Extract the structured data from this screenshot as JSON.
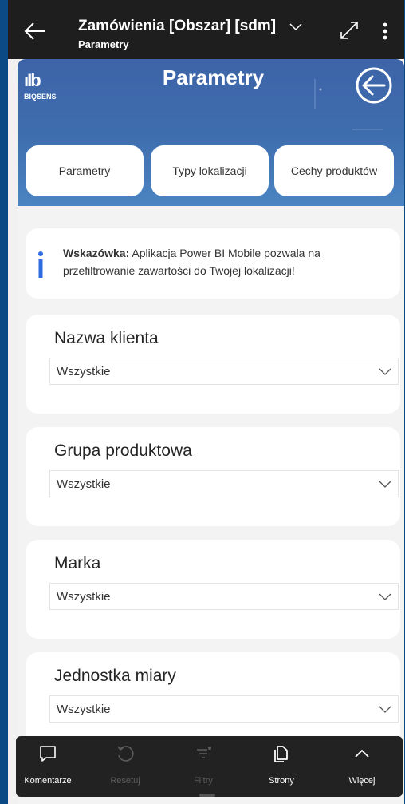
{
  "appbar": {
    "title": "Zamówienia [Obszar] [sdm]",
    "subtitle": "Parametry"
  },
  "banner": {
    "logo_mark": "ıIb",
    "logo_name": "BIQSENS",
    "title": "Parametry",
    "tabs": [
      {
        "label": "Parametry"
      },
      {
        "label": "Typy lokalizacji"
      },
      {
        "label": "Cechy produktów"
      }
    ]
  },
  "hint": {
    "bold": "Wskazówka:",
    "text": " Aplikacja Power BI Mobile pozwala na przefiltrowanie zawartości do Twojej lokalizacji!"
  },
  "filters": [
    {
      "label": "Nazwa klienta",
      "value": "Wszystkie"
    },
    {
      "label": "Grupa produktowa",
      "value": "Wszystkie"
    },
    {
      "label": "Marka",
      "value": "Wszystkie"
    },
    {
      "label": "Jednostka miary",
      "value": "Wszystkie"
    }
  ],
  "toolbar": {
    "items": [
      {
        "label": "Komentarze",
        "icon": "comment-icon",
        "enabled": true
      },
      {
        "label": "Resetuj",
        "icon": "undo-icon",
        "enabled": false
      },
      {
        "label": "Filtry",
        "icon": "filter-icon",
        "enabled": false
      },
      {
        "label": "Strony",
        "icon": "pages-icon",
        "enabled": true
      },
      {
        "label": "Więcej",
        "icon": "chevron-up-icon",
        "enabled": true
      }
    ]
  },
  "colors": {
    "appbar": "#1e1e1e",
    "banner": "#3e6dae",
    "hint_icon": "#2f6de0",
    "toolbar": "#222222"
  }
}
